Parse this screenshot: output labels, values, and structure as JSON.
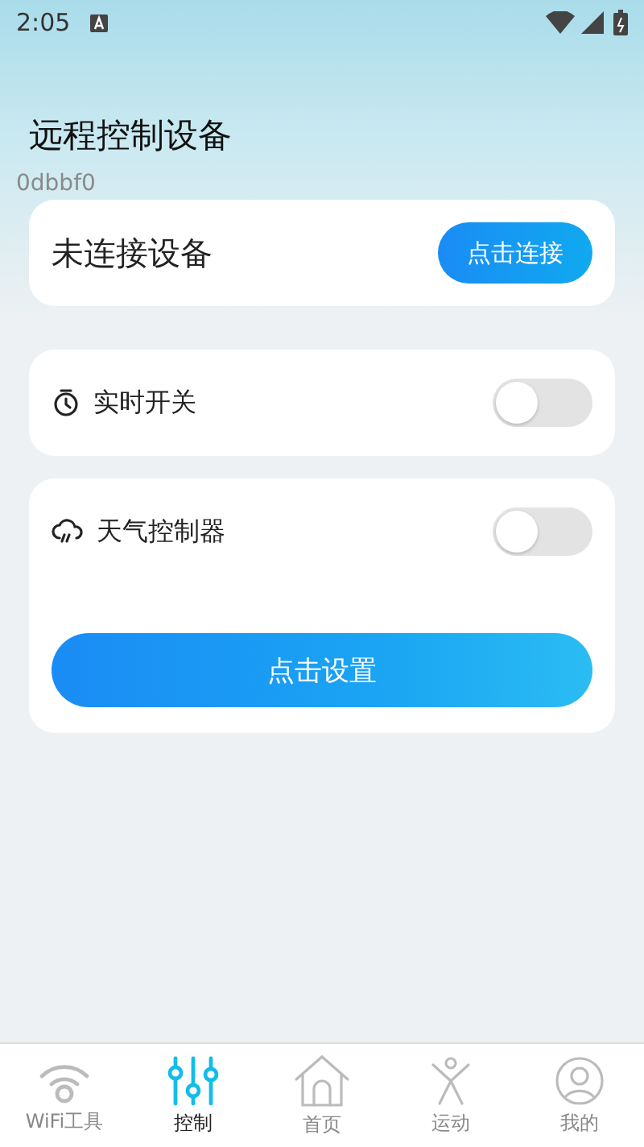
{
  "status_bar": {
    "time": "2:05"
  },
  "header": {
    "title": "远程控制设备",
    "debug_text": "0dbbf0"
  },
  "device_card": {
    "status": "未连接设备",
    "button": "点击连接"
  },
  "switches": [
    {
      "kind": "timer",
      "label": "实时开关",
      "on": false
    },
    {
      "kind": "weather",
      "label": "天气控制器",
      "on": false,
      "button": "点击设置"
    }
  ],
  "tab_bar": [
    {
      "kind": "wifi",
      "label": "WiFi工具",
      "selected": false
    },
    {
      "kind": "sliders",
      "label": "控制",
      "selected": true
    },
    {
      "kind": "home",
      "label": "首页",
      "selected": false
    },
    {
      "kind": "person",
      "label": "运动",
      "selected": false
    },
    {
      "kind": "user",
      "label": "我的",
      "selected": false
    }
  ]
}
